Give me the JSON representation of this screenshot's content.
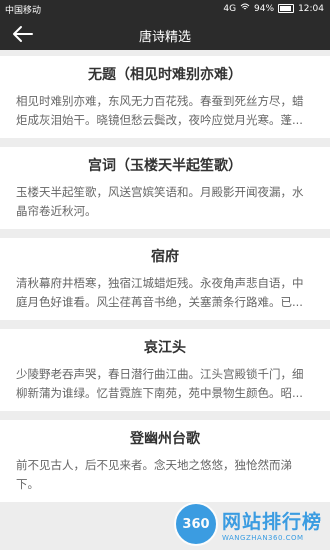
{
  "status_bar": {
    "carrier": "中国移动",
    "network": "4G",
    "battery": "94%",
    "time": "12:04"
  },
  "toolbar": {
    "title": "唐诗精选"
  },
  "poems": [
    {
      "title": "无题（相见时难别亦难）",
      "excerpt": "相见时难别亦难，东风无力百花残。春蚕到死丝方尽，蜡炬成灰泪始干。晓镜但愁云鬓改，夜吟应觉月光寒。蓬..."
    },
    {
      "title": "宫词（玉楼天半起笙歌）",
      "excerpt": "玉楼天半起笙歌，风送宫嫔笑语和。月殿影开闻夜漏，水晶帘卷近秋河。"
    },
    {
      "title": "宿府",
      "excerpt": "清秋幕府井梧寒，独宿江城蜡炬残。永夜角声悲自语，中庭月色好谁看。风尘荏苒音书绝，关塞萧条行路难。已..."
    },
    {
      "title": "哀江头",
      "excerpt": "少陵野老吞声哭，春日潜行曲江曲。江头宫殿锁千门，细柳新蒲为谁绿。忆昔霓旌下南苑，苑中景物生颜色。昭..."
    },
    {
      "title": "登幽州台歌",
      "excerpt": "前不见古人，后不见来者。念天地之悠悠，独怆然而涕下。"
    }
  ],
  "watermark": {
    "badge": "360",
    "name": "网站排行榜",
    "url": "WANGZHAN360.COM"
  }
}
